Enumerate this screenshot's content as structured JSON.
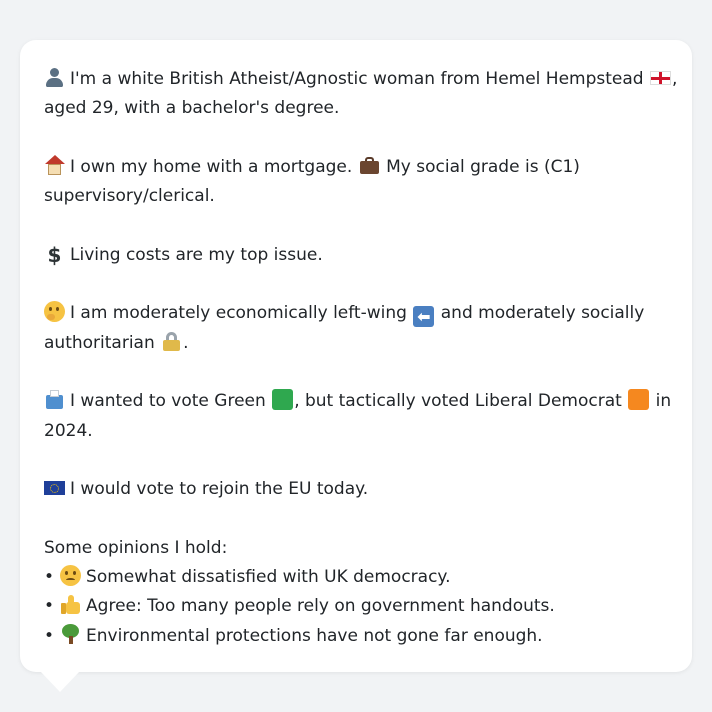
{
  "profile": {
    "intro_line1": "I'm a white British Atheist/Agnostic woman from Hemel Hempstead",
    "intro_line1_tail": ",",
    "intro_line2": "aged 29, with a bachelor's degree.",
    "home_text": "I own my home with a mortgage.",
    "grade_text": "My social grade is (C1)",
    "grade_text_line2": "supervisory/clerical.",
    "issue_text": "Living costs are my top issue.",
    "ideology_text1": "I am moderately economically left-wing",
    "ideology_text2": "and moderately socially",
    "ideology_line2": "authoritarian",
    "ideology_tail": ".",
    "vote_text1": "I wanted to vote Green",
    "vote_text2": ", but tactically voted Liberal Democrat",
    "vote_text3": "in",
    "vote_line2": "2024.",
    "eu_text": "I would vote to rejoin the EU today."
  },
  "opinions": {
    "heading": "Some opinions I hold:",
    "bullet": "•",
    "items": [
      {
        "icon": "slightly-frowning-face-icon",
        "text": "Somewhat dissatisfied with UK democracy."
      },
      {
        "icon": "thumbs-up-icon",
        "text": "Agree: Too many people rely on government handouts."
      },
      {
        "icon": "deciduous-tree-icon",
        "text": "Environmental protections have not gone far enough."
      }
    ]
  },
  "icons": {
    "left_arrow_glyph": "⬅",
    "dollar_glyph": "$"
  },
  "colors": {
    "page_background": "#f1f3f5",
    "bubble_background": "#ffffff",
    "text": "#212529",
    "green_square": "#2fa84f",
    "orange_square": "#f5881f"
  }
}
